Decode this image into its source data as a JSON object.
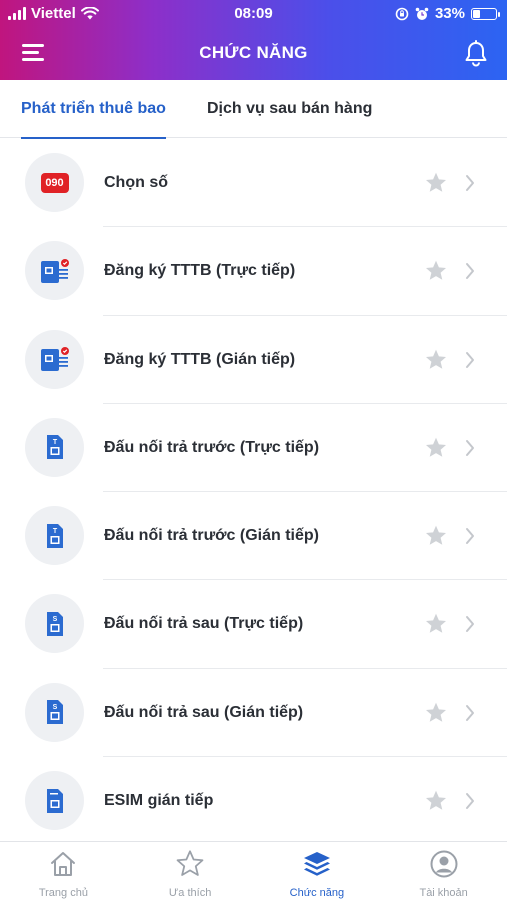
{
  "status_bar": {
    "carrier": "Viettel",
    "time": "08:09",
    "battery_text": "33%",
    "battery_level": 0.33
  },
  "header": {
    "title": "CHỨC NĂNG",
    "menu_icon": "hamburger-menu-icon",
    "bell_icon": "bell-icon"
  },
  "tabs": [
    {
      "label": "Phát triển thuê bao",
      "active": true
    },
    {
      "label": "Dịch vụ sau bán hàng",
      "active": false
    }
  ],
  "list": [
    {
      "label": "Chọn số",
      "icon": "number-090-icon",
      "badge_text": "090"
    },
    {
      "label": "Đăng ký TTTB (Trực tiếp)",
      "icon": "sim-register-icon"
    },
    {
      "label": "Đăng ký TTTB (Gián tiếp)",
      "icon": "sim-register-icon"
    },
    {
      "label": "Đấu nối trả trước (Trực tiếp)",
      "icon": "prepaid-sim-icon"
    },
    {
      "label": "Đấu nối trả trước (Gián tiếp)",
      "icon": "prepaid-sim-icon"
    },
    {
      "label": "Đấu nối trả sau (Trực tiếp)",
      "icon": "postpaid-sim-icon"
    },
    {
      "label": "Đấu nối trả sau (Gián tiếp)",
      "icon": "postpaid-sim-icon"
    },
    {
      "label": "ESIM gián tiếp",
      "icon": "esim-icon"
    }
  ],
  "bottom_nav": [
    {
      "label": "Trang chủ",
      "icon": "home-icon",
      "active": false
    },
    {
      "label": "Ưa thích",
      "icon": "star-icon",
      "active": false
    },
    {
      "label": "Chức năng",
      "icon": "layers-icon",
      "active": true
    },
    {
      "label": "Tài khoản",
      "icon": "account-icon",
      "active": false
    }
  ],
  "colors": {
    "accent": "#2661c9",
    "header_gradient": [
      "#c0157e",
      "#8d2fc9",
      "#4b4fea",
      "#2c64f2"
    ],
    "badge_red": "#e02226"
  }
}
